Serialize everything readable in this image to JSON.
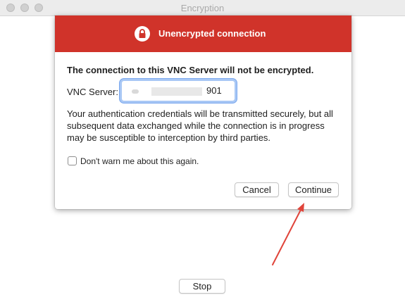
{
  "window": {
    "title": "Encryption"
  },
  "dialog": {
    "banner_title": "Unencrypted connection",
    "headline": "The connection to this VNC Server will not be encrypted.",
    "server_label": "VNC Server:",
    "server_value_suffix": "901",
    "description": "Your authentication credentials will be transmitted securely, but all subsequent data exchanged while the connection is in progress may be susceptible to interception by third parties.",
    "checkbox_label": "Don't warn me about this again.",
    "checkbox_checked": false,
    "cancel_label": "Cancel",
    "continue_label": "Continue"
  },
  "footer": {
    "stop_label": "Stop"
  },
  "colors": {
    "banner": "#d0332a",
    "annotation_arrow": "#e0443a",
    "focus_ring": "#7aa7ee"
  },
  "icons": {
    "banner_icon": "lock-icon"
  }
}
